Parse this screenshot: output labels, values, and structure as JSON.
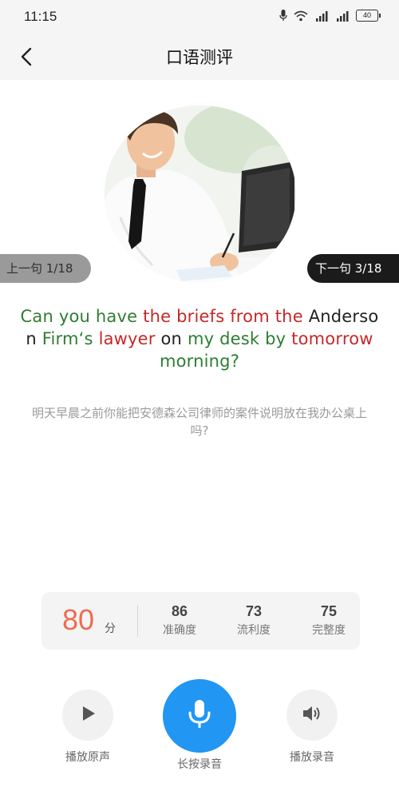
{
  "status_bar": {
    "time": "11:15",
    "battery": "40",
    "icons": [
      "mic-icon",
      "wifi-icon",
      "signal-4g-icon",
      "signal-4g-icon",
      "battery-icon"
    ]
  },
  "header": {
    "title": "口语测评",
    "back_icon": "chevron-left-icon"
  },
  "navigation": {
    "prev_label": "上一句 1/18",
    "next_label": "下一句 3/18"
  },
  "sentence": {
    "segments": [
      {
        "text": "Can you have ",
        "color": "green"
      },
      {
        "text": "the briefs from the ",
        "color": "red"
      },
      {
        "text": "Anderson ",
        "color": "black"
      },
      {
        "text": "Firm‘s ",
        "color": "green"
      },
      {
        "text": "lawyer ",
        "color": "red"
      },
      {
        "text": "on ",
        "color": "black"
      },
      {
        "text": "my desk by ",
        "color": "green"
      },
      {
        "text": "tomorrow ",
        "color": "red"
      },
      {
        "text": "morning?",
        "color": "green"
      }
    ],
    "translation": "明天早晨之前你能把安德森公司律师的案件说明放在我办公桌上吗?"
  },
  "scores": {
    "total": "80",
    "total_unit": "分",
    "items": [
      {
        "value": "86",
        "label": "准确度"
      },
      {
        "value": "73",
        "label": "流利度"
      },
      {
        "value": "75",
        "label": "完整度"
      }
    ]
  },
  "controls": {
    "play_original": "播放原声",
    "hold_record": "长按录音",
    "play_recording": "播放录音"
  },
  "colors": {
    "green": "#2e7d32",
    "red": "#c62828",
    "black": "#222222",
    "accent_blue": "#2196f3",
    "score_orange": "#ef6b50"
  }
}
